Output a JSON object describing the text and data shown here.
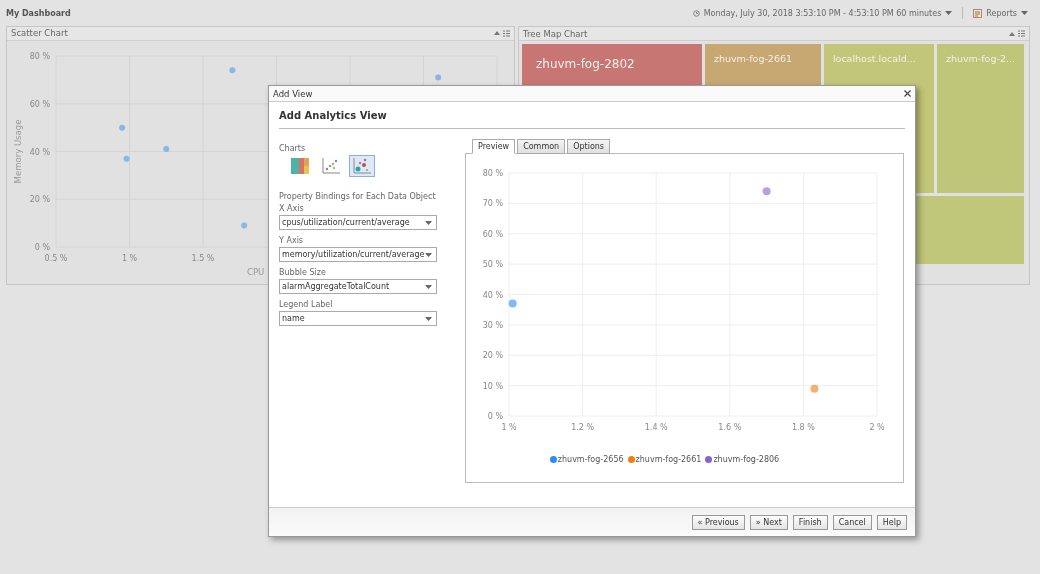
{
  "header": {
    "title": "My Dashboard",
    "time_range": "Monday, July 30, 2018 3:53:10 PM - 4:53:10 PM 60 minutes",
    "reports": "Reports"
  },
  "scatter_panel": {
    "title": "Scatter Chart",
    "chart_data": {
      "type": "scatter",
      "grid": true,
      "xlabel": "CPU",
      "ylabel": "Memory Usage",
      "xlim": [
        0.5,
        3.5
      ],
      "ylim": [
        0,
        80
      ],
      "xticks": [
        {
          "value": 0.5,
          "label": "0.5 %"
        },
        {
          "value": 1,
          "label": "1 %"
        },
        {
          "value": 1.5,
          "label": "1.5 %"
        }
      ],
      "yticks": [
        {
          "value": 0,
          "label": "0 %"
        },
        {
          "value": 20,
          "label": "20 %"
        },
        {
          "value": 40,
          "label": "40 %"
        },
        {
          "value": 60,
          "label": "60 %"
        },
        {
          "value": 80,
          "label": "80 %"
        }
      ],
      "series": [
        {
          "color": "#8ab6e2",
          "x": [
            0.95,
            0.98,
            1.25,
            1.7,
            1.78,
            3.1
          ],
          "values": [
            50,
            37,
            41,
            74,
            9,
            71
          ]
        }
      ]
    }
  },
  "treemap_panel": {
    "title": "Tree Map Chart",
    "tiles": [
      {
        "label": "zhuvm-fog-2802",
        "color": "#c87674"
      },
      {
        "label": "zhuvm-fog-2661",
        "color": "#c8a872"
      },
      {
        "label": "localhost.locald...",
        "color": "#c2c678"
      },
      {
        "label": "zhuvm-fog-2...",
        "color": "#bec679"
      },
      {
        "color": "#c0c77a"
      }
    ]
  },
  "dialog": {
    "title": "Add View",
    "heading": "Add Analytics View",
    "charts_label": "Charts",
    "chart_types": [
      {
        "kind": "treemap",
        "selected": false
      },
      {
        "kind": "scatter",
        "selected": false
      },
      {
        "kind": "bubble",
        "selected": true
      }
    ],
    "bindings_label": "Property Bindings for Each Data Object",
    "fields": [
      {
        "label": "X Axis",
        "value": "cpus/utilization/current/average"
      },
      {
        "label": "Y Axis",
        "value": "memory/utilization/current/average"
      },
      {
        "label": "Bubble Size",
        "value": "alarmAggregateTotalCount"
      },
      {
        "label": "Legend Label",
        "value": "name"
      }
    ],
    "tabs": [
      {
        "label": "Preview",
        "selected": true
      },
      {
        "label": "Common",
        "selected": false
      },
      {
        "label": "Options",
        "selected": false
      }
    ],
    "preview": {
      "chart_data": {
        "type": "scatter",
        "grid": true,
        "xlim": [
          1,
          2
        ],
        "ylim": [
          0,
          80
        ],
        "xticks": [
          {
            "value": 1,
            "label": "1 %"
          },
          {
            "value": 1.2,
            "label": "1.2 %"
          },
          {
            "value": 1.4,
            "label": "1.4 %"
          },
          {
            "value": 1.6,
            "label": "1.6 %"
          },
          {
            "value": 1.8,
            "label": "1.8 %"
          },
          {
            "value": 2,
            "label": "2 %"
          }
        ],
        "yticks": [
          {
            "value": 0,
            "label": "0 %"
          },
          {
            "value": 10,
            "label": "10 %"
          },
          {
            "value": 20,
            "label": "20 %"
          },
          {
            "value": 30,
            "label": "30 %"
          },
          {
            "value": 40,
            "label": "40 %"
          },
          {
            "value": 50,
            "label": "50 %"
          },
          {
            "value": 60,
            "label": "60 %"
          },
          {
            "value": 70,
            "label": "70 %"
          },
          {
            "value": 80,
            "label": "80 %"
          }
        ],
        "series": [
          {
            "name": "zhuvm-fog-2656",
            "color": "#2a8ef0",
            "x": [
              1.01
            ],
            "values": [
              37
            ]
          },
          {
            "name": "zhuvm-fog-2661",
            "color": "#ee7d12",
            "x": [
              1.83
            ],
            "values": [
              9
            ]
          },
          {
            "name": "zhuvm-fog-2806",
            "color": "#8a5fd0",
            "x": [
              1.7
            ],
            "values": [
              74
            ]
          }
        ]
      }
    },
    "buttons": [
      "« Previous",
      "» Next",
      "Finish",
      "Cancel",
      "Help"
    ]
  }
}
